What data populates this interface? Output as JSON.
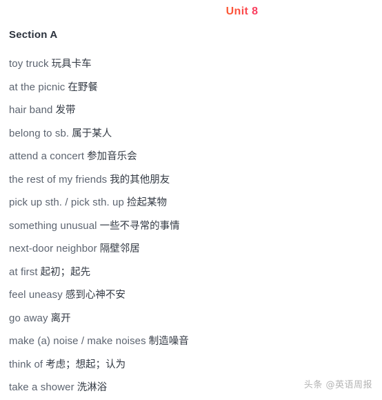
{
  "page": {
    "background_color": "#ffffff"
  },
  "unit": {
    "title": "Unit 8",
    "gradient_start_color": "#fb5a33",
    "gradient_end_color": "#f93a64"
  },
  "section": {
    "title": "Section A",
    "color": "#2b323d"
  },
  "vocabulary": {
    "english_color": "#5c6470",
    "chinese_color": "#333a44",
    "items": [
      {
        "en": "toy truck",
        "cn": "玩具卡车"
      },
      {
        "en": "at the picnic",
        "cn": "在野餐"
      },
      {
        "en": "hair band",
        "cn": "发带"
      },
      {
        "en": "belong to sb.",
        "cn": "属于某人"
      },
      {
        "en": "attend a concert",
        "cn": "参加音乐会"
      },
      {
        "en": "the rest of my friends",
        "cn": "我的其他朋友"
      },
      {
        "en": "pick up sth. / pick sth. up",
        "cn": "捡起某物"
      },
      {
        "en": "something unusual",
        "cn": "一些不寻常的事情"
      },
      {
        "en": "next-door neighbor",
        "cn": "隔壁邻居"
      },
      {
        "en": "at first",
        "cn": "起初；起先"
      },
      {
        "en": "feel uneasy",
        "cn": "感到心神不安"
      },
      {
        "en": "go away",
        "cn": "离开"
      },
      {
        "en": "make (a) noise / make noises",
        "cn": "制造噪音"
      },
      {
        "en": "think of",
        "cn": "考虑；想起；认为"
      },
      {
        "en": "take a shower",
        "cn": "洗淋浴"
      }
    ]
  },
  "watermark": {
    "text": "头条 @英语周报",
    "color": "#a9a9a9"
  }
}
